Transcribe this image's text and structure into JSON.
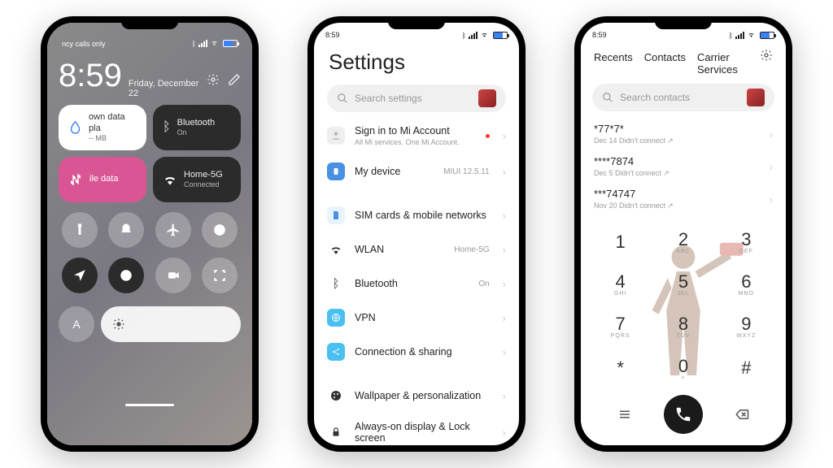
{
  "status": {
    "time": "8:59",
    "carrier": "ncy calls only"
  },
  "cc": {
    "time": "8:59",
    "date": "Friday, December 22",
    "tiles": {
      "data_plan_label": "own data pla",
      "data_plan_value": "-- MB",
      "bt_label": "Bluetooth",
      "bt_status": "On",
      "mobile_label": "ile data",
      "wifi_label": "Home-5G",
      "wifi_status": "Connected"
    },
    "auto": "A"
  },
  "settings": {
    "title": "Settings",
    "search_placeholder": "Search settings",
    "signin_label": "Sign in to Mi Account",
    "signin_sub": "All Mi services. One Mi Account.",
    "items": [
      {
        "label": "My device",
        "value": "MIUI 12.5.11"
      },
      {
        "label": "SIM cards & mobile networks",
        "value": ""
      },
      {
        "label": "WLAN",
        "value": "Home-5G"
      },
      {
        "label": "Bluetooth",
        "value": "On"
      },
      {
        "label": "VPN",
        "value": ""
      },
      {
        "label": "Connection & sharing",
        "value": ""
      },
      {
        "label": "Wallpaper & personalization",
        "value": ""
      },
      {
        "label": "Always-on display & Lock screen",
        "value": ""
      }
    ]
  },
  "dialer": {
    "tabs": [
      "Recents",
      "Contacts",
      "Carrier Services"
    ],
    "search_placeholder": "Search contacts",
    "recents": [
      {
        "number": "*77*7*",
        "date": "Dec 14 Didn't connect ↗"
      },
      {
        "number": "****7874",
        "date": "Dec 5 Didn't connect ↗"
      },
      {
        "number": "***74747",
        "date": "Nov 20 Didn't connect ↗"
      }
    ],
    "keys": [
      {
        "d": "1",
        "l": ""
      },
      {
        "d": "2",
        "l": "ABC"
      },
      {
        "d": "3",
        "l": "DEF"
      },
      {
        "d": "4",
        "l": "GHI"
      },
      {
        "d": "5",
        "l": "JKL"
      },
      {
        "d": "6",
        "l": "MNO"
      },
      {
        "d": "7",
        "l": "PQRS"
      },
      {
        "d": "8",
        "l": "TUV"
      },
      {
        "d": "9",
        "l": "WXYZ"
      },
      {
        "d": "*",
        "l": ""
      },
      {
        "d": "0",
        "l": "+"
      },
      {
        "d": "#",
        "l": ""
      }
    ]
  }
}
